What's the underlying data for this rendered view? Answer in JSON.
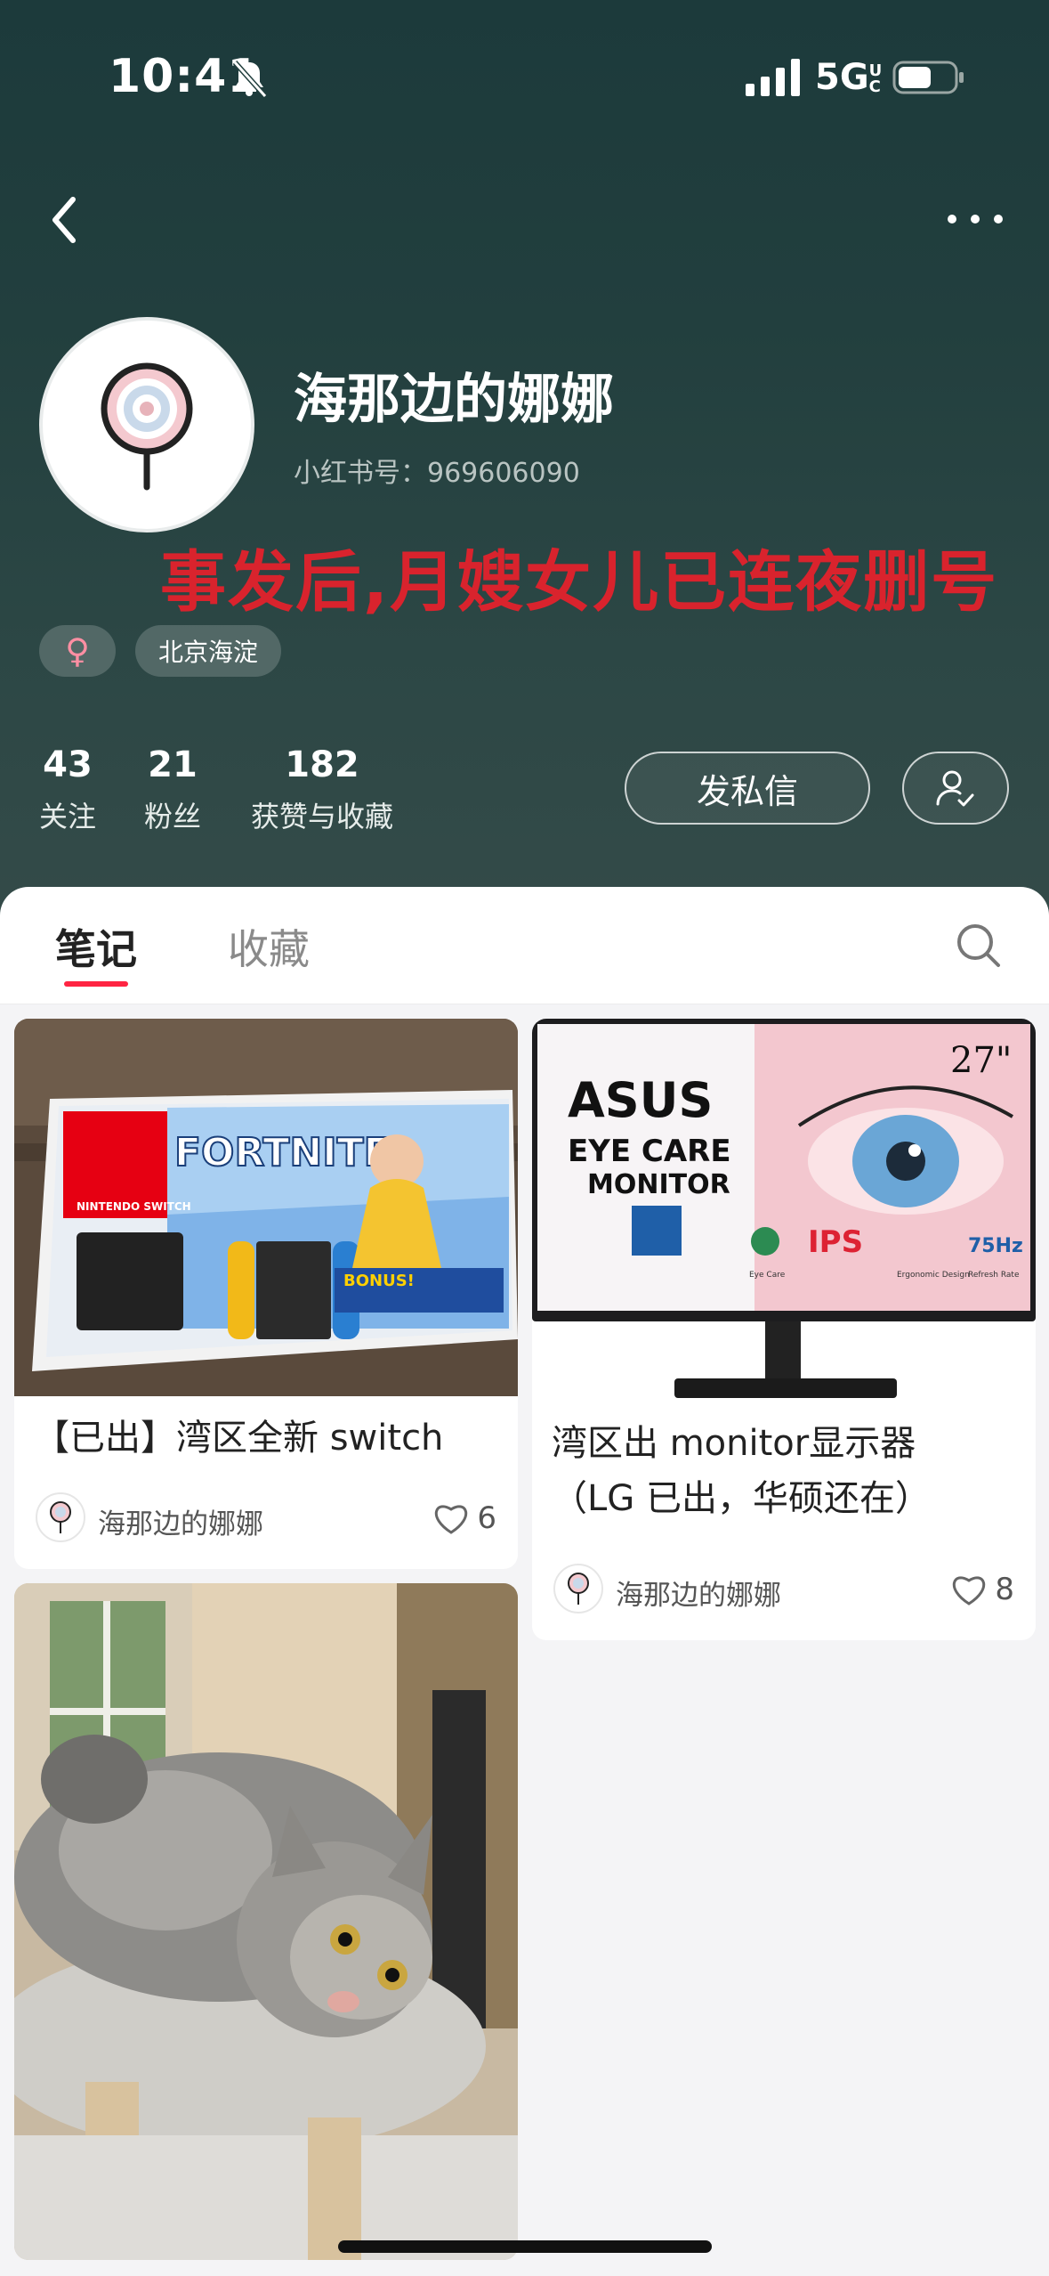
{
  "status_bar": {
    "time": "10:41",
    "network": "5G",
    "network_sub": "UC"
  },
  "profile": {
    "username": "海那边的娜娜",
    "id_label": "小红书号：",
    "id_value": "969606090",
    "gender_symbol": "♀",
    "location": "北京海淀",
    "overlay_caption": "事发后,月嫂女儿已连夜删号"
  },
  "stats": [
    {
      "value": "43",
      "label": "关注"
    },
    {
      "value": "21",
      "label": "粉丝"
    },
    {
      "value": "182",
      "label": "获赞与收藏"
    }
  ],
  "actions": {
    "message_label": "发私信"
  },
  "tabs": [
    {
      "label": "笔记",
      "active": true
    },
    {
      "label": "收藏",
      "active": false
    }
  ],
  "posts": [
    {
      "title": "【已出】湾区全新 switch",
      "author": "海那边的娜娜",
      "likes": "6",
      "image_text": {
        "brand": "NINTENDO SWITCH",
        "game": "FORTNITE",
        "bonus": "BONUS!"
      }
    },
    {
      "title_line1": "湾区出 monitor显示器",
      "title_line2": "（LG 已出，华硕还在）",
      "author": "海那边的娜娜",
      "likes": "8",
      "image_text": {
        "brand": "ASUS",
        "line1": "EYE CARE",
        "line2": "MONITOR",
        "size": "27\"",
        "ips": "IPS",
        "hz": "75Hz",
        "badge1": "Eye Care",
        "badge2": "Ergonomic Design",
        "badge3": "Refresh Rate"
      }
    },
    {
      "title": "",
      "author": "",
      "likes": ""
    }
  ],
  "colors": {
    "accent": "#ff2442",
    "caption_red": "#d9232d",
    "hero_bg": "#223f3e"
  }
}
